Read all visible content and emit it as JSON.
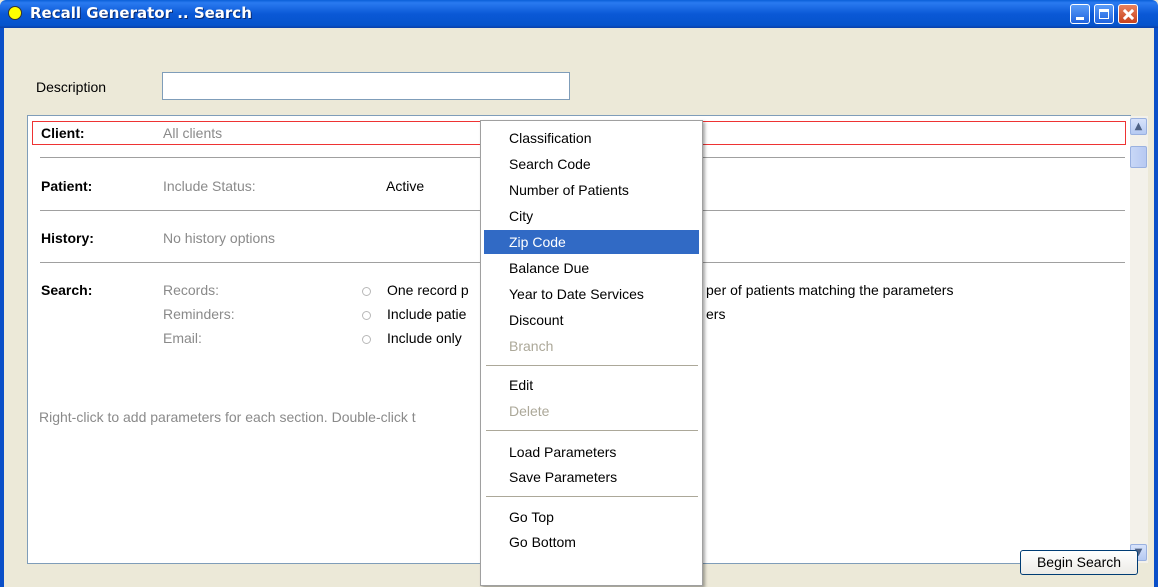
{
  "window": {
    "title": "Recall Generator .. Search"
  },
  "description": {
    "label": "Description",
    "value": ""
  },
  "sections": {
    "client": {
      "label": "Client:",
      "value": "All clients"
    },
    "patient": {
      "label": "Patient:",
      "field_label": "Include Status:",
      "field_value": "Active"
    },
    "history": {
      "label": "History:",
      "value": "No history options"
    },
    "search": {
      "label": "Search:",
      "rows": [
        {
          "label": "Records:",
          "text_left": "One record p",
          "text_right": "per of patients matching the parameters"
        },
        {
          "label": "Reminders:",
          "text_left": "Include patie",
          "text_right": "ers"
        },
        {
          "label": "Email:",
          "text_left": "Include only",
          "text_right": ""
        }
      ]
    }
  },
  "hint": "Right-click to add parameters for each section. Double-click t",
  "begin_button": "Begin Search",
  "context_menu": {
    "groups": [
      [
        {
          "label": "Classification",
          "state": "normal"
        },
        {
          "label": "Search Code",
          "state": "normal"
        },
        {
          "label": "Number of Patients",
          "state": "normal"
        },
        {
          "label": "City",
          "state": "normal"
        },
        {
          "label": "Zip Code",
          "state": "selected"
        },
        {
          "label": "Balance Due",
          "state": "normal"
        },
        {
          "label": "Year to Date Services",
          "state": "normal"
        },
        {
          "label": "Discount",
          "state": "normal"
        },
        {
          "label": "Branch",
          "state": "disabled"
        }
      ],
      [
        {
          "label": "Edit",
          "state": "normal"
        },
        {
          "label": "Delete",
          "state": "disabled"
        }
      ],
      [
        {
          "label": "Load Parameters",
          "state": "normal"
        },
        {
          "label": "Save Parameters",
          "state": "normal"
        }
      ],
      [
        {
          "label": "Go Top",
          "state": "normal"
        },
        {
          "label": "Go Bottom",
          "state": "normal"
        }
      ]
    ]
  },
  "colors": {
    "titlebar": "#0a58d6",
    "selection": "#316ac5",
    "client_highlight": "#ee3333"
  },
  "icons": {
    "title": "yellow-circle-icon",
    "scroll_up": "scroll-up-arrow-icon",
    "scroll_down": "scroll-down-arrow-icon"
  }
}
